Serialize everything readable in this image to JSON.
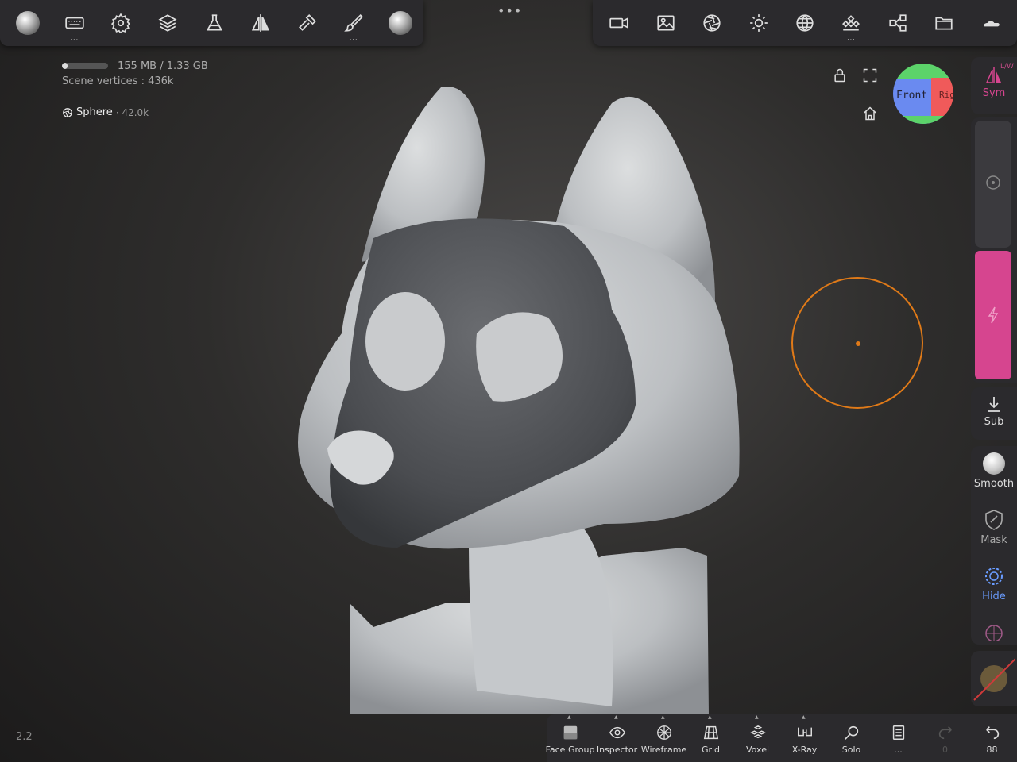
{
  "top_bar": {
    "left_items": [
      {
        "name": "sculpt-tools-icon"
      },
      {
        "name": "keyboard-icon",
        "more": "..."
      },
      {
        "name": "gear-icon"
      },
      {
        "name": "layers-icon"
      },
      {
        "name": "flask-icon"
      },
      {
        "name": "symmetry-icon"
      },
      {
        "name": "hammer-icon"
      },
      {
        "name": "paint-brush-icon",
        "more": "..."
      },
      {
        "name": "material-sphere-icon"
      }
    ],
    "center_more": "•••",
    "right_items": [
      {
        "name": "camera-icon"
      },
      {
        "name": "image-icon"
      },
      {
        "name": "aperture-icon"
      },
      {
        "name": "sun-icon"
      },
      {
        "name": "globe-icon"
      },
      {
        "name": "stack-icon",
        "more": "..."
      },
      {
        "name": "share-nodes-icon"
      },
      {
        "name": "folder-icon"
      },
      {
        "name": "cloud-icon"
      }
    ]
  },
  "info": {
    "memory": "155 MB / 1.33 GB",
    "memory_fraction": 0.12,
    "scene_vertices_label": "Scene vertices :",
    "scene_vertices_value": "436k",
    "object_name": "Sphere",
    "object_vertices": "· 42.0k"
  },
  "version": "2.2",
  "gizmo": {
    "front": "Front",
    "right": "Righ"
  },
  "right_panel": {
    "sym_label": "Sym",
    "lw_label": "L/W",
    "radius_fraction": 0.0,
    "intensity_fraction": 1.0,
    "sub_label": "Sub",
    "smooth_label": "Smooth",
    "mask_label": "Mask",
    "hide_label": "Hide"
  },
  "bottom_bar": {
    "items": [
      {
        "label": "Face Group"
      },
      {
        "label": "Inspector"
      },
      {
        "label": "Wireframe"
      },
      {
        "label": "Grid"
      },
      {
        "label": "Voxel"
      },
      {
        "label": "X-Ray"
      },
      {
        "label": "Solo"
      },
      {
        "label": "..."
      },
      {
        "label": "0"
      },
      {
        "label": "88"
      }
    ]
  },
  "colors": {
    "accent_pink": "#d6458f",
    "brush_orange": "#e07a18",
    "hide_blue": "#6a9cff"
  }
}
